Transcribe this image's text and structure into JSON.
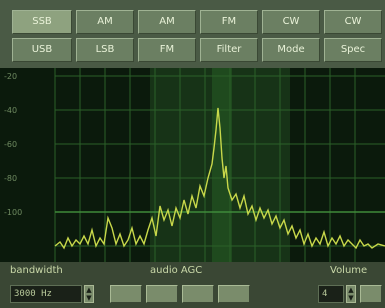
{
  "toolbar": {
    "row1": [
      "SSB",
      "AM",
      "AM",
      "FM",
      "CW",
      "CW"
    ],
    "row2": [
      "USB",
      "LSB",
      "FM",
      "Filter",
      "Mode",
      "Spec"
    ],
    "active_index": 0
  },
  "plot": {
    "y_ticks": [
      "-20",
      "-40",
      "-60",
      "-80",
      "-100"
    ],
    "trace_color": "#c8d84a",
    "grid_color": "#2d6a2a",
    "band_color": "#1f3a1c"
  },
  "bottom": {
    "bandwidth_label": "bandwidth",
    "bandwidth_value": "3000 Hz",
    "audio_label": "audio AGC",
    "volume_label": "Volume",
    "volume_value": "4"
  }
}
